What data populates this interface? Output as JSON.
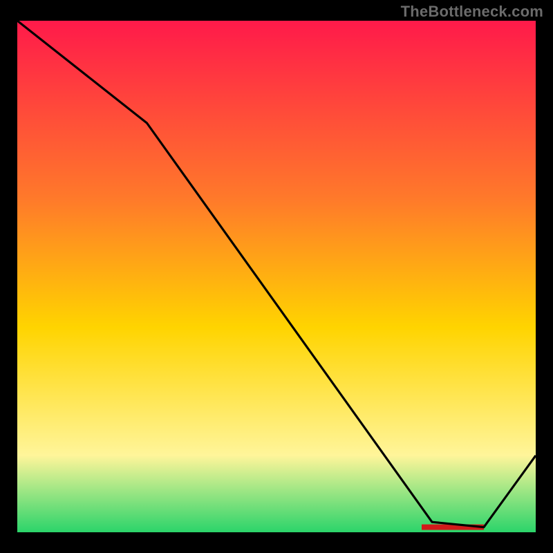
{
  "watermark": "TheBottleneck.com",
  "colors": {
    "gradient_top": "#ff1a4a",
    "gradient_q1": "#ff7a2a",
    "gradient_mid": "#ffd400",
    "gradient_q3": "#fff59a",
    "gradient_bottom": "#2bd46a",
    "line": "#000000",
    "red_bar": "#d11a1a",
    "frame": "#000000"
  },
  "chart_data": {
    "type": "line",
    "title": "",
    "xlabel": "",
    "ylabel": "",
    "xlim": [
      0,
      100
    ],
    "ylim": [
      0,
      100
    ],
    "x": [
      0,
      25,
      80,
      90,
      100
    ],
    "values": [
      100,
      80,
      2,
      1,
      15
    ],
    "optimal_range_x": [
      78,
      90
    ],
    "optimal_y": 1
  }
}
